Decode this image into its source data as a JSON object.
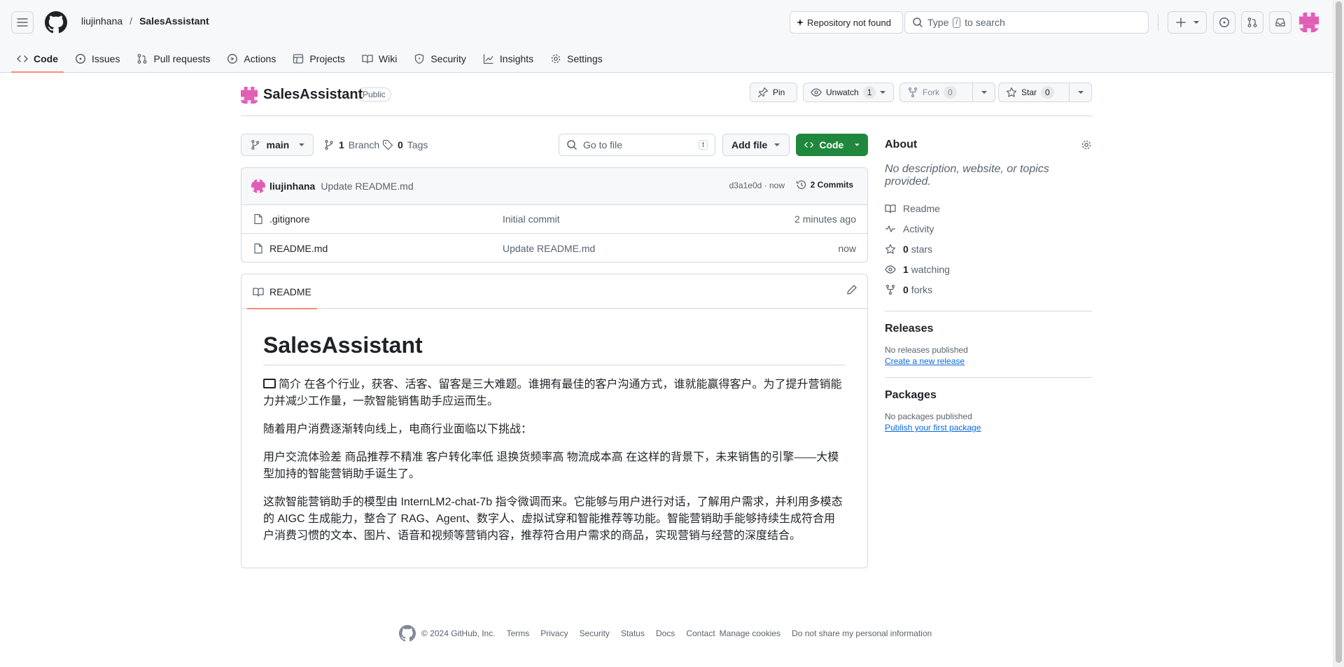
{
  "header": {
    "owner": "liujinhana",
    "separator": "/",
    "repo": "SalesAssistant",
    "repo_not_found": "Repository not found",
    "search_pre": "Type",
    "search_key": "/",
    "search_post": "to search"
  },
  "nav": {
    "tabs": [
      {
        "label": "Code",
        "icon": "code-icon"
      },
      {
        "label": "Issues",
        "icon": "issue-icon"
      },
      {
        "label": "Pull requests",
        "icon": "pull-request-icon"
      },
      {
        "label": "Actions",
        "icon": "play-icon"
      },
      {
        "label": "Projects",
        "icon": "table-icon"
      },
      {
        "label": "Wiki",
        "icon": "book-icon"
      },
      {
        "label": "Security",
        "icon": "shield-icon"
      },
      {
        "label": "Insights",
        "icon": "graph-icon"
      },
      {
        "label": "Settings",
        "icon": "gear-icon"
      }
    ]
  },
  "repo": {
    "name": "SalesAssistant",
    "visibility": "Public",
    "pin_label": "Pin",
    "unwatch_label": "Unwatch",
    "watch_count": "1",
    "fork_label": "Fork",
    "fork_count": "0",
    "star_label": "Star",
    "star_count": "0"
  },
  "toolbar": {
    "branch": "main",
    "branches_count": "1",
    "branches_label": "Branch",
    "tags_count": "0",
    "tags_label": "Tags",
    "goto_placeholder": "Go to file",
    "goto_key": "t",
    "add_file": "Add file",
    "code_button": "Code"
  },
  "commit": {
    "author": "liujinhana",
    "message": "Update README.md",
    "hash_time": "d3a1e0d · now",
    "commits_label": "2 Commits"
  },
  "files": [
    {
      "name": ".gitignore",
      "message": "Initial commit",
      "age": "2 minutes ago"
    },
    {
      "name": "README.md",
      "message": "Update README.md",
      "age": "now"
    }
  ],
  "readme": {
    "tab_label": "README",
    "title": "SalesAssistant",
    "p1": "简介 在各个行业，获客、活客、留客是三大难题。谁拥有最佳的客户沟通方式，谁就能赢得客户。为了提升营销能力并减少工作量，一款智能销售助手应运而生。",
    "p2": "随着用户消费逐渐转向线上，电商行业面临以下挑战：",
    "p3": "用户交流体验差 商品推荐不精准 客户转化率低 退换货频率高 物流成本高 在这样的背景下，未来销售的引擎——大模型加持的智能营销助手诞生了。",
    "p4": "这款智能营销助手的模型由 InternLM2-chat-7b 指令微调而来。它能够与用户进行对话，了解用户需求，并利用多模态的 AIGC 生成能力，整合了 RAG、Agent、数字人、虚拟试穿和智能推荐等功能。智能营销助手能够持续生成符合用户消费习惯的文本、图片、语音和视频等营销内容，推荐符合用户需求的商品，实现营销与经营的深度结合。"
  },
  "about": {
    "title": "About",
    "description": "No description, website, or topics provided.",
    "readme": "Readme",
    "activity": "Activity",
    "stars_count": "0",
    "stars_label": "stars",
    "watching_count": "1",
    "watching_label": "watching",
    "forks_count": "0",
    "forks_label": "forks"
  },
  "releases": {
    "title": "Releases",
    "status": "No releases published",
    "link": "Create a new release"
  },
  "packages": {
    "title": "Packages",
    "status": "No packages published",
    "link": "Publish your first package"
  },
  "footer": {
    "copyright": "© 2024 GitHub, Inc.",
    "links": [
      "Terms",
      "Privacy",
      "Security",
      "Status",
      "Docs",
      "Contact",
      "Manage cookies",
      "Do not share my personal information"
    ]
  },
  "colors": {
    "accent_underline": "#fd8c73",
    "code_button": "#1f883d",
    "link": "#0969da",
    "avatar_pink": "#e05fb5"
  }
}
